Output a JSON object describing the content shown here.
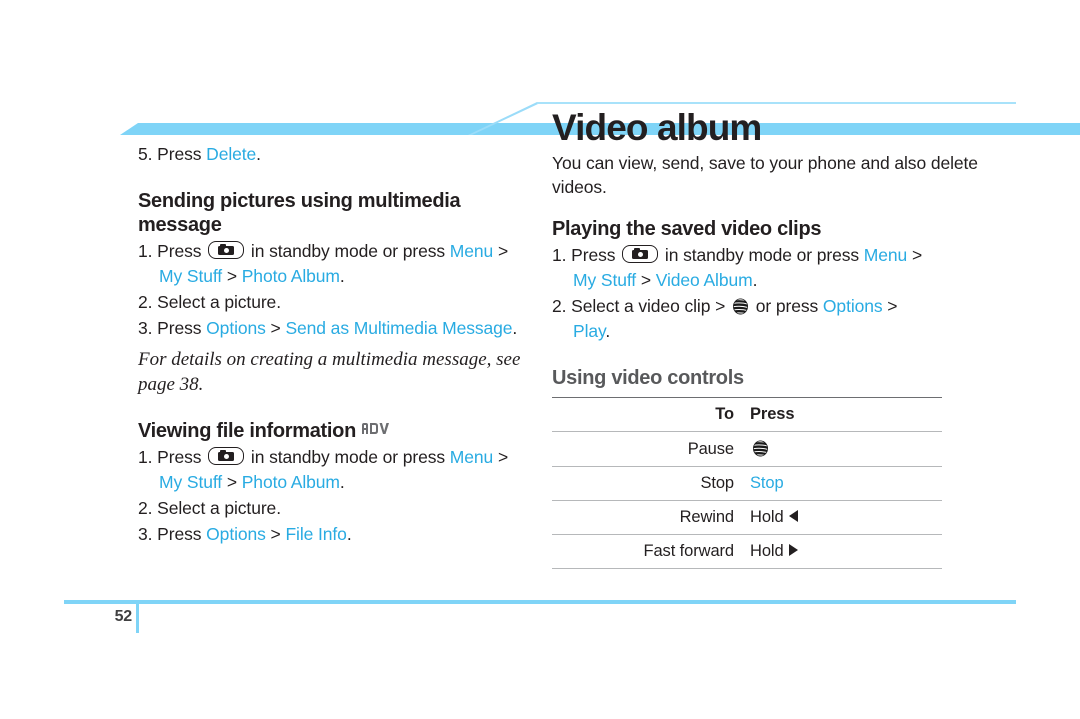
{
  "document": {
    "page_number": "52",
    "accent_color": "#29abe2",
    "banner_color": "#7fd4f7",
    "heading_gray": "#58595b"
  },
  "left_column": {
    "step5": {
      "number": "5.",
      "press_label": "Press ",
      "action": "Delete",
      "period": "."
    },
    "section_sending": {
      "heading": "Sending pictures using multimedia message",
      "steps": [
        {
          "number": "1.",
          "text_a": "Press ",
          "icon": "camera-key-icon",
          "text_b": " in standby mode or press ",
          "link_a": "Menu",
          "sep_a": " > ",
          "link_b": "My Stuff",
          "sep_b": " > ",
          "link_c": "Photo Album",
          "tail": "."
        },
        {
          "number": "2.",
          "text_a": "Select a picture."
        },
        {
          "number": "3.",
          "text_a": "Press ",
          "link_a": "Options",
          "sep_a": " > ",
          "link_b": "Send as Multimedia Message",
          "tail": "."
        }
      ],
      "note": "For details on creating a multimedia message, see page 38."
    },
    "section_viewing": {
      "heading": "Viewing file information",
      "badge": "ADV",
      "badge_icon": "adv-badge-icon",
      "steps": [
        {
          "number": "1.",
          "text_a": "Press ",
          "icon": "camera-key-icon",
          "text_b": " in standby mode or press ",
          "link_a": "Menu",
          "sep_a": " > ",
          "link_b": "My Stuff",
          "sep_b": " > ",
          "link_c": "Photo Album",
          "tail": "."
        },
        {
          "number": "2.",
          "text_a": "Select a picture."
        },
        {
          "number": "3.",
          "text_a": "Press ",
          "link_a": "Options",
          "sep_a": " > ",
          "link_b": "File Info",
          "tail": "."
        }
      ]
    }
  },
  "right_column": {
    "title": "Video album",
    "intro": "You can view, send, save to your phone and also delete videos.",
    "section_playing": {
      "heading": "Playing the saved video clips",
      "steps": [
        {
          "number": "1.",
          "text_a": "Press ",
          "icon": "camera-key-icon",
          "text_b": " in standby mode or press ",
          "link_a": "Menu",
          "sep_a": " > ",
          "link_b": "My Stuff",
          "sep_b": " > ",
          "link_c": "Video Album",
          "tail": "."
        },
        {
          "number": "2.",
          "text_a": "Select a video clip > ",
          "icon": "att-globe-icon",
          "text_b": " or press ",
          "link_a": "Options",
          "sep_a": " > ",
          "link_b": "Play",
          "tail": "."
        }
      ]
    },
    "section_controls": {
      "heading": "Using video controls",
      "table": {
        "columns": [
          "To",
          "Press"
        ],
        "rows": [
          {
            "to": "Pause",
            "press_text": "",
            "press_icon": "att-globe-icon",
            "press_is_link": false
          },
          {
            "to": "Stop",
            "press_text": "Stop",
            "press_icon": "",
            "press_is_link": true
          },
          {
            "to": "Rewind",
            "press_text": "Hold ",
            "press_icon": "arrow-left-icon",
            "press_is_link": false
          },
          {
            "to": "Fast forward",
            "press_text": "Hold ",
            "press_icon": "arrow-right-icon",
            "press_is_link": false
          }
        ]
      }
    }
  }
}
